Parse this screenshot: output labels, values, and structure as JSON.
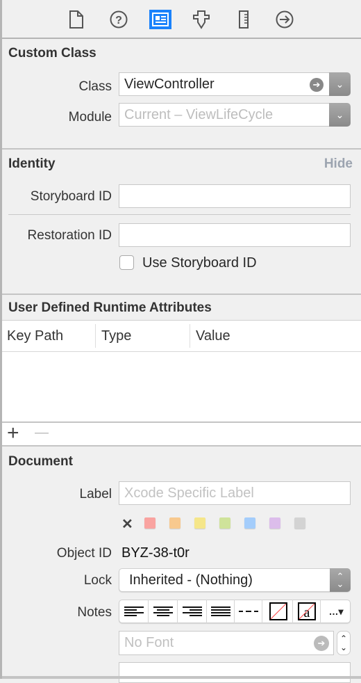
{
  "toolbar": {
    "icons": [
      "file-inspector-icon",
      "quick-help-icon",
      "identity-inspector-icon",
      "attributes-inspector-icon",
      "size-inspector-icon",
      "connections-inspector-icon"
    ],
    "active": "identity-inspector-icon",
    "accent": "#1a82fb"
  },
  "custom_class": {
    "title": "Custom Class",
    "class_label": "Class",
    "class_value": "ViewController",
    "module_label": "Module",
    "module_placeholder": "Current – ViewLifeCycle"
  },
  "identity": {
    "title": "Identity",
    "hide": "Hide",
    "storyboard_id_label": "Storyboard ID",
    "storyboard_id_value": "",
    "restoration_id_label": "Restoration ID",
    "restoration_id_value": "",
    "use_storyboard_id": "Use Storyboard ID",
    "use_storyboard_checked": false
  },
  "runtime_attributes": {
    "title": "User Defined Runtime Attributes",
    "columns": [
      "Key Path",
      "Type",
      "Value"
    ],
    "add": "+",
    "remove": "—"
  },
  "document": {
    "title": "Document",
    "label_label": "Label",
    "label_placeholder": "Xcode Specific Label",
    "clear": "✕",
    "colors": [
      "#f9a3a0",
      "#f8c98e",
      "#f5e68a",
      "#cfe39a",
      "#a4cdfb",
      "#dcbdeb",
      "#d3d3d3"
    ],
    "object_id_label": "Object ID",
    "object_id_value": "BYZ-38-t0r",
    "lock_label": "Lock",
    "lock_value": "Inherited - (Nothing)",
    "notes_label": "Notes",
    "font_placeholder": "No Font"
  }
}
